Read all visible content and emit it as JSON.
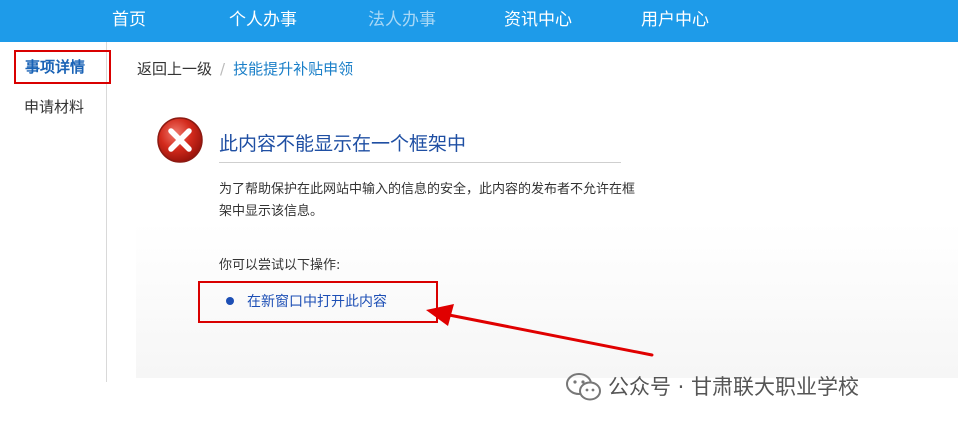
{
  "nav": {
    "items": [
      {
        "label": "首页"
      },
      {
        "label": "个人办事"
      },
      {
        "label": "法人办事"
      },
      {
        "label": "资讯中心"
      },
      {
        "label": "用户中心"
      }
    ]
  },
  "sidebar": {
    "items": [
      {
        "label": "事项详情",
        "active": true
      },
      {
        "label": "申请材料",
        "active": false
      }
    ]
  },
  "breadcrumb": {
    "back": "返回上一级",
    "separator": "/",
    "current": "技能提升补贴申领"
  },
  "error": {
    "icon": "error-x-icon",
    "title": "此内容不能显示在一个框架中",
    "description": "为了帮助保护在此网站中输入的信息的安全，此内容的发布者不允许在框架中显示该信息。",
    "try_label": "你可以尝试以下操作:",
    "action_link": "在新窗口中打开此内容"
  },
  "watermark": {
    "text": "公众号 · 甘肃联大职业学校"
  },
  "colors": {
    "nav_bg": "#1e9be9",
    "highlight_red": "#d90000",
    "link_blue": "#1d4fb5",
    "title_blue": "#1f4fa3"
  }
}
